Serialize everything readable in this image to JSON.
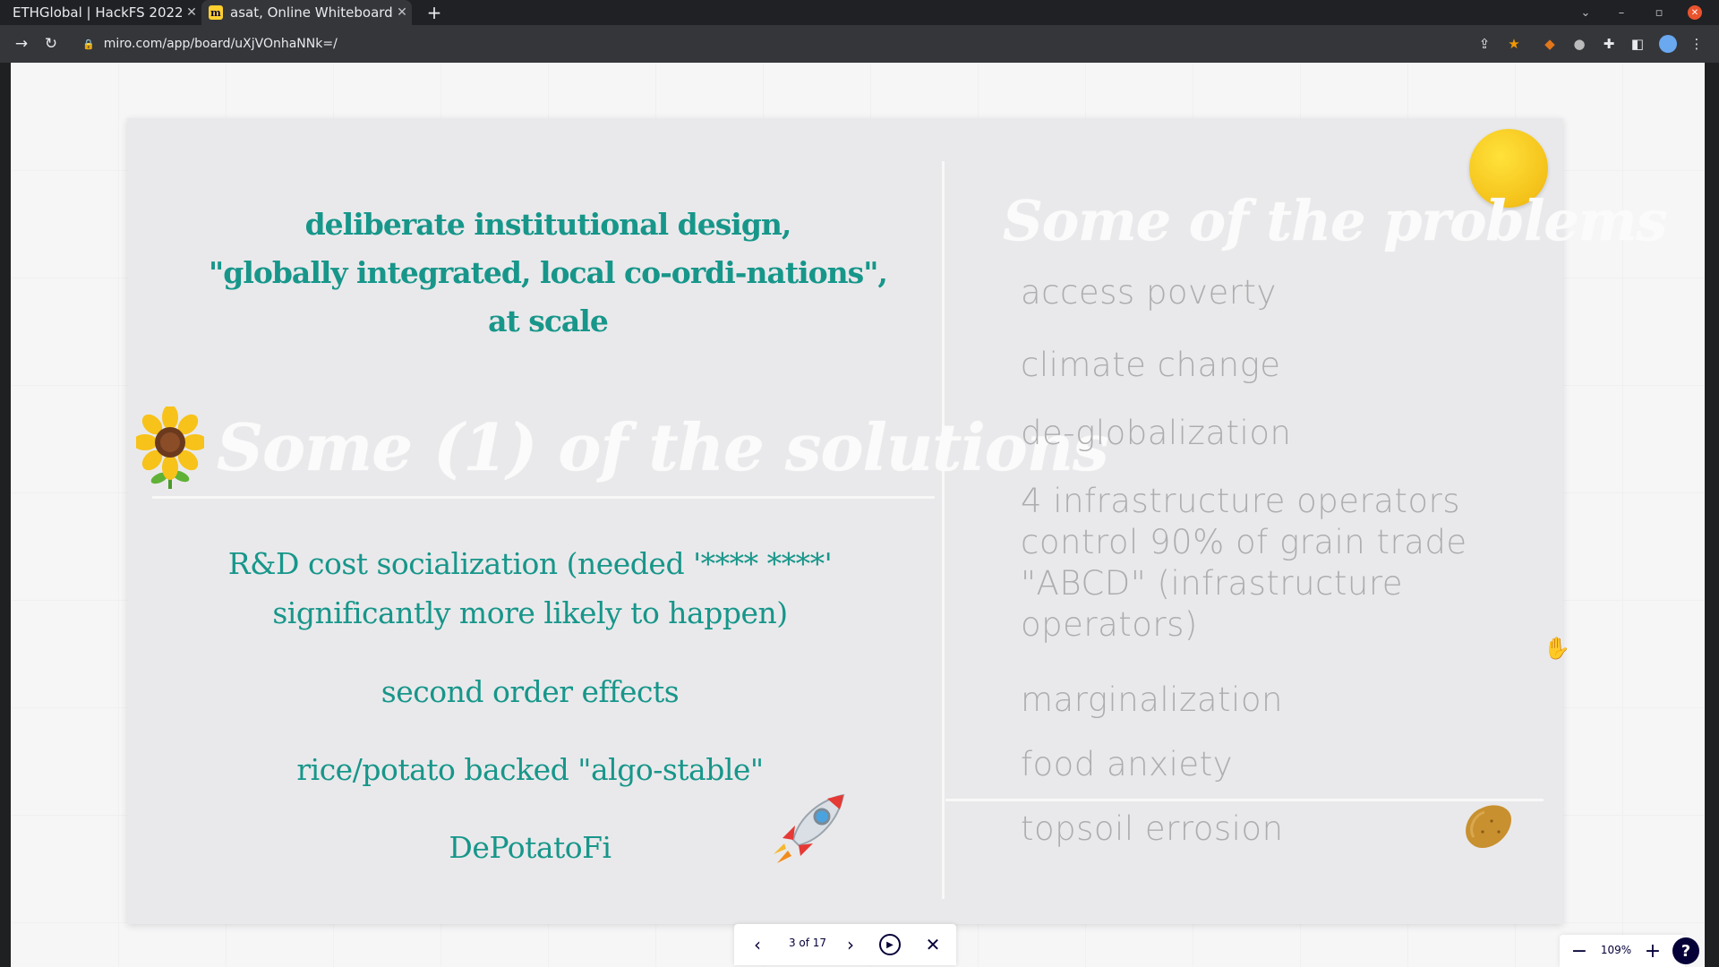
{
  "browser": {
    "tabs": [
      {
        "title": "ETHGlobal | HackFS 2022",
        "active": false
      },
      {
        "title": "asat, Online Whiteboard",
        "active": true
      }
    ],
    "url": "miro.com/app/board/uXjVOnhaNNk=/",
    "icons": {
      "back": "arrow-right-icon",
      "reload": "reload-icon",
      "share": "share-icon",
      "bookmark": "star-icon",
      "extensions": "puzzle-icon"
    }
  },
  "slide": {
    "intro": [
      "deliberate institutional design,",
      "\"globally integrated, local co-ordi-nations\",",
      "at scale"
    ],
    "solutions_title": "Some (1) of the solutions",
    "solutions": [
      "R&D cost socialization (needed '**** ****'",
      "significantly more likely to happen)",
      "second order effects",
      "rice/potato backed \"algo-stable\"",
      "DePotatoFi"
    ],
    "problems_title": "Some of the problems",
    "problems": [
      "access poverty",
      "climate change",
      "de-globalization",
      "4 infrastructure operators control 90% of grain trade \"ABCD\" (infrastructure operators)",
      "marginalization",
      "food anxiety",
      "topsoil errosion"
    ]
  },
  "presenter": {
    "page_counter": "3 of 17"
  },
  "zoom": {
    "level": "109%",
    "help": "?"
  },
  "colors": {
    "teal_text": "#17968a",
    "problem_text": "#adadaf",
    "sun": "#f4c21a"
  }
}
